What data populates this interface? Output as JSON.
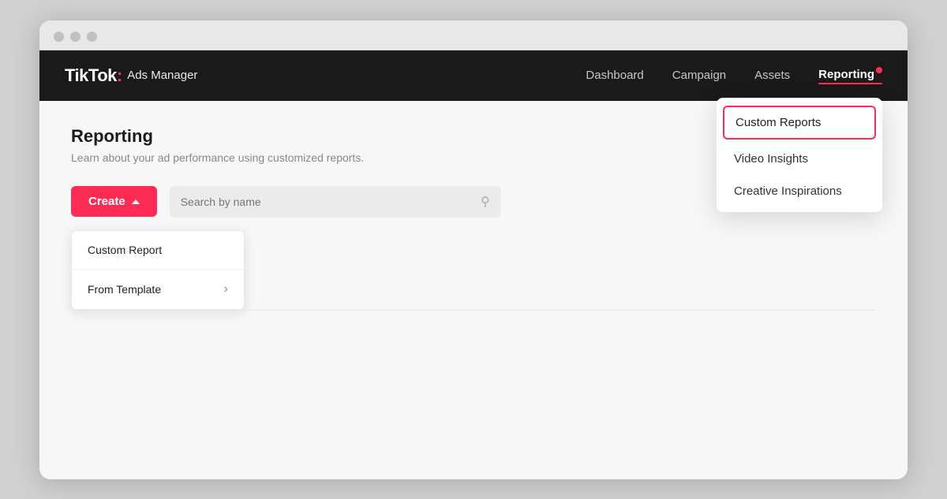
{
  "browser": {
    "dots": [
      "dot1",
      "dot2",
      "dot3"
    ]
  },
  "navbar": {
    "logo_tiktok": "TikTok",
    "logo_colon": ":",
    "logo_ads": "Ads Manager",
    "links": [
      {
        "label": "Dashboard",
        "active": false
      },
      {
        "label": "Campaign",
        "active": false
      },
      {
        "label": "Assets",
        "active": false
      },
      {
        "label": "Reporting",
        "active": true
      }
    ]
  },
  "dropdown": {
    "items": [
      {
        "label": "Custom Reports",
        "highlighted": true
      },
      {
        "label": "Video Insights",
        "highlighted": false
      },
      {
        "label": "Creative Inspirations",
        "highlighted": false
      }
    ]
  },
  "page": {
    "title": "Reporting",
    "subtitle": "Learn about your ad performance using customized reports.",
    "create_btn": "Create",
    "search_placeholder": "Search by name"
  },
  "create_dropdown": {
    "items": [
      {
        "label": "Custom Report",
        "has_arrow": false
      },
      {
        "label": "From Template",
        "has_arrow": true
      }
    ]
  }
}
